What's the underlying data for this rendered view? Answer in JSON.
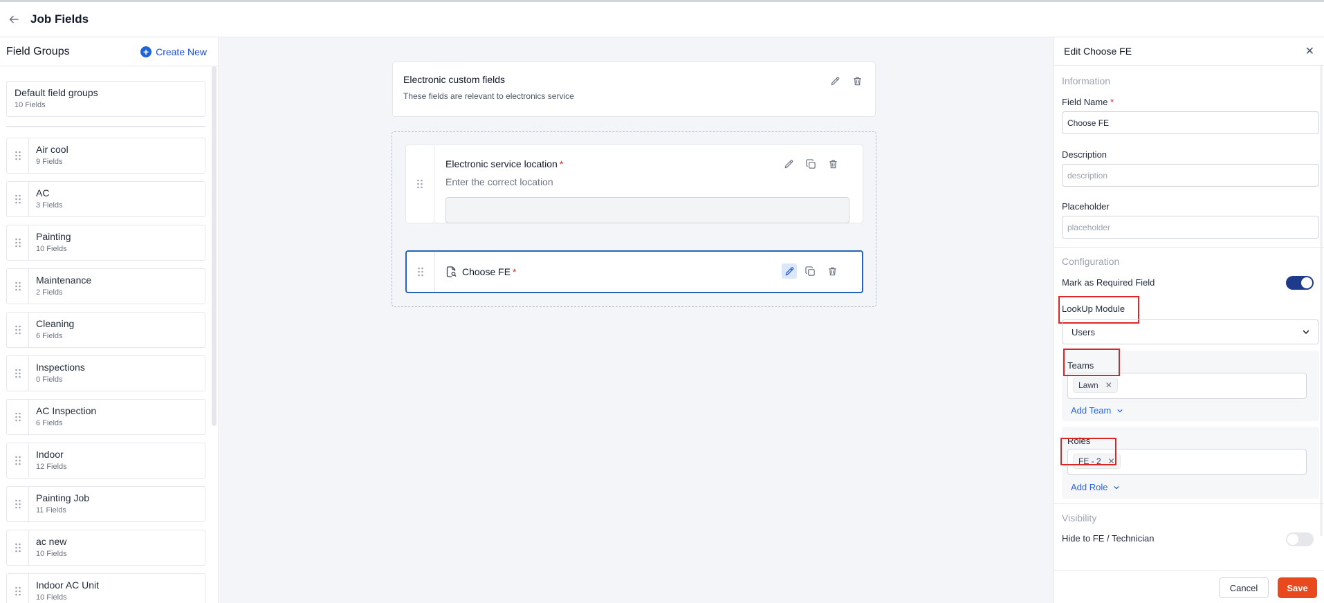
{
  "header": {
    "title": "Job Fields"
  },
  "sidebar": {
    "title": "Field Groups",
    "create_new": "Create New",
    "default_group": {
      "name": "Default field groups",
      "count": "10 Fields"
    },
    "groups": [
      {
        "name": "Air cool",
        "count": "9 Fields"
      },
      {
        "name": "AC",
        "count": "3 Fields"
      },
      {
        "name": "Painting",
        "count": "10 Fields"
      },
      {
        "name": "Maintenance",
        "count": "2 Fields"
      },
      {
        "name": "Cleaning",
        "count": "6 Fields"
      },
      {
        "name": "Inspections",
        "count": "0 Fields"
      },
      {
        "name": "AC Inspection",
        "count": "6 Fields"
      },
      {
        "name": "Indoor",
        "count": "12 Fields"
      },
      {
        "name": "Painting Job",
        "count": "11 Fields"
      },
      {
        "name": "ac new",
        "count": "10 Fields"
      },
      {
        "name": "Indoor AC Unit",
        "count": "10 Fields"
      }
    ]
  },
  "canvas": {
    "section": {
      "title": "Electronic custom fields",
      "description": "These fields are relevant to electronics service"
    },
    "fields": [
      {
        "title": "Electronic service location",
        "required": "*",
        "description": "Enter the correct location"
      },
      {
        "title": "Choose FE",
        "required": "*"
      }
    ]
  },
  "panel": {
    "title": "Edit Choose FE",
    "information_label": "Information",
    "field_name_label": "Field Name",
    "required_mark": "*",
    "field_name_value": "Choose FE",
    "description_label": "Description",
    "description_placeholder": "description",
    "placeholder_label": "Placeholder",
    "placeholder_placeholder": "placeholder",
    "configuration_label": "Configuration",
    "mark_required_label": "Mark as Required Field",
    "mark_required_on": true,
    "lookup_label": "LookUp Module",
    "lookup_value": "Users",
    "teams_label": "Teams",
    "teams": [
      "Lawn"
    ],
    "add_team": "Add Team",
    "roles_label": "Roles",
    "roles": [
      "FE - 2"
    ],
    "add_role": "Add Role",
    "visibility_label": "Visibility",
    "hide_label": "Hide to FE / Technician",
    "hide_on": false,
    "cancel": "Cancel",
    "save": "Save"
  },
  "colors": {
    "accent": "#1d64d8",
    "save": "#e8491d",
    "highlight": "#dc2626",
    "toggle_on": "#1e3a8a"
  }
}
